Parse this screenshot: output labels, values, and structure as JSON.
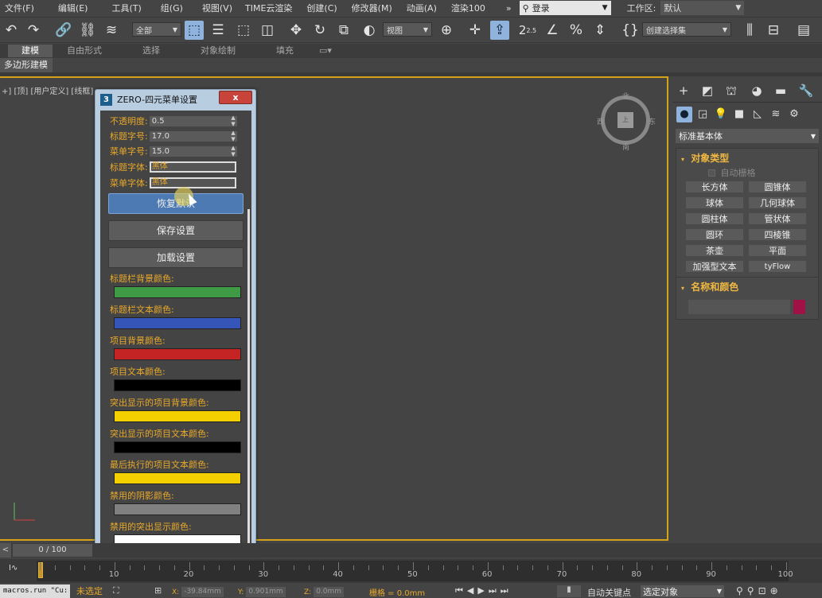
{
  "menubar": {
    "items": [
      "文件(F)",
      "编辑(E)",
      "工具(T)",
      "组(G)",
      "视图(V)",
      "TIME云渲染",
      "创建(C)",
      "修改器(M)",
      "动画(A)",
      "渲染100",
      "»"
    ],
    "login_label": "登录",
    "workspace_label": "工作区:",
    "workspace_value": "默认"
  },
  "toolbar": {
    "filter_value": "全部",
    "refcoord_value": "视图",
    "selset_value": "创建选择集",
    "snap_angle": "2.5"
  },
  "ribbon": {
    "tabs": [
      "建模",
      "自由形式",
      "选择",
      "对象绘制",
      "填充"
    ],
    "subtab": "多边形建模"
  },
  "viewport": {
    "label": "+] [顶] [用户定义] [线框]",
    "viewcube_face": "上",
    "compass": {
      "north": "北",
      "south": "南",
      "east": "东",
      "west": "西"
    }
  },
  "dialog": {
    "icon": "3",
    "title": "ZERO-四元菜单设置",
    "close": "x",
    "fields": {
      "opacity_label": "不透明度:",
      "opacity_value": "0.5",
      "title_size_label": "标题字号:",
      "title_size_value": "17.0",
      "menu_size_label": "菜单字号:",
      "menu_size_value": "15.0",
      "title_font_label": "标题字体:",
      "title_font_value": "黑体",
      "menu_font_label": "菜单字体:",
      "menu_font_value": "黑体"
    },
    "buttons": {
      "reset": "恢复默认",
      "save": "保存设置",
      "load": "加载设置"
    },
    "colors": [
      {
        "label": "标题栏背景颜色:",
        "color": "#3f9a46"
      },
      {
        "label": "标题栏文本颜色:",
        "color": "#3556b8"
      },
      {
        "label": "项目背景颜色:",
        "color": "#c42424"
      },
      {
        "label": "项目文本颜色:",
        "color": "#000000"
      },
      {
        "label": "突出显示的项目背景颜色:",
        "color": "#f5d000"
      },
      {
        "label": "突出显示的项目文本颜色:",
        "color": "#000000"
      },
      {
        "label": "最后执行的项目文本颜色:",
        "color": "#f5d000"
      },
      {
        "label": "禁用的阴影颜色:",
        "color": "#808080"
      },
      {
        "label": "禁用的突出显示颜色:",
        "color": "#ffffff"
      }
    ]
  },
  "cmdpanel": {
    "category": "标准基本体",
    "object_type_title": "对象类型",
    "autogrid": "自动栅格",
    "objects": [
      "长方体",
      "圆锥体",
      "球体",
      "几何球体",
      "圆柱体",
      "管状体",
      "圆环",
      "四棱锥",
      "茶壶",
      "平面",
      "加强型文本",
      "tyFlow"
    ],
    "name_color_title": "名称和颜色",
    "object_color": "#a01245"
  },
  "timeslider": {
    "position": "0 / 100",
    "ticks": [
      "10",
      "20",
      "30",
      "40",
      "50",
      "60",
      "70",
      "80",
      "90",
      "100"
    ]
  },
  "status": {
    "maxscript": "macros.run \"Cu:",
    "selection": "未选定",
    "x_label": "X:",
    "x_value": "-39.84mm",
    "y_label": "Y:",
    "y_value": "0.901mm",
    "z_label": "Z:",
    "z_value": "0.0mm",
    "grid": "栅格 = 0.0mm",
    "autokey": "自动关键点",
    "selset": "选定对象"
  }
}
